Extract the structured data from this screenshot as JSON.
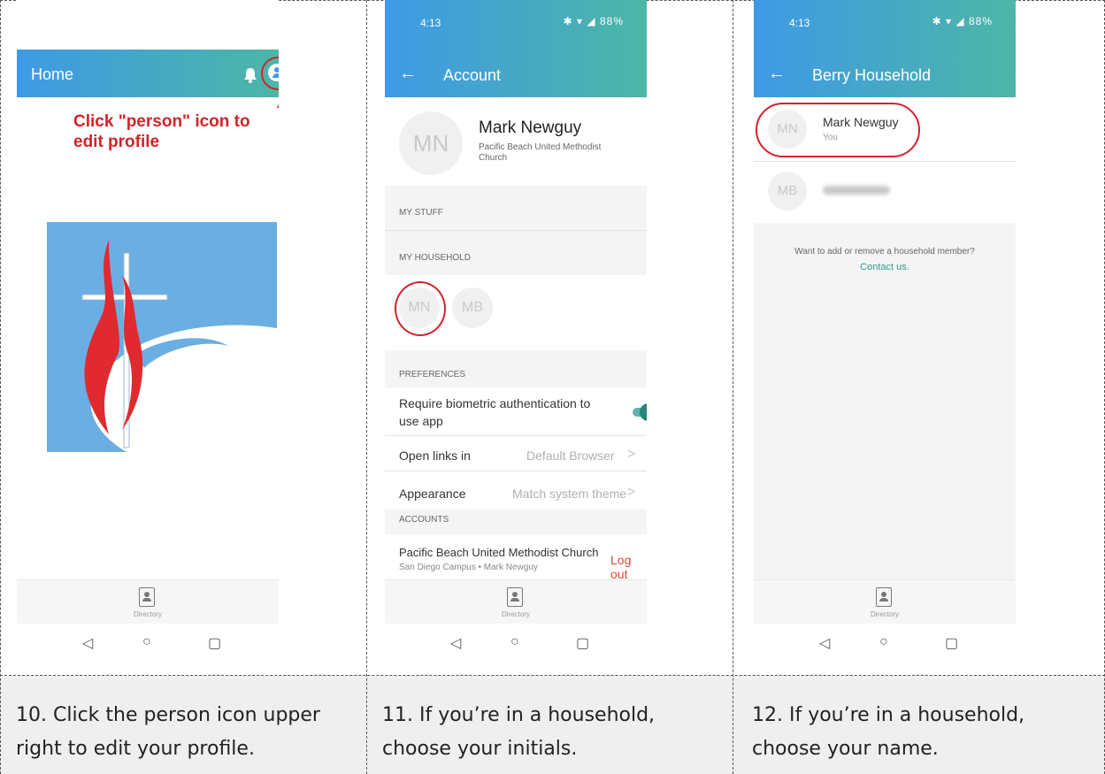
{
  "phone1": {
    "appbar_title": "Home",
    "annotation": "Click \"person\" icon to edit profile",
    "directory_label": "Directory"
  },
  "phone2": {
    "status_time": "4:13",
    "status_icons": "✱ ▾ ◢ 88%",
    "title": "Account",
    "profile_initials": "MN",
    "profile_name": "Mark Newguy",
    "profile_church": "Pacific Beach United Methodist Church",
    "my_stuff": "MY STUFF",
    "my_household": "MY HOUSEHOLD",
    "household_initials": [
      "MN",
      "MB"
    ],
    "preferences": "PREFERENCES",
    "biometric_label": "Require biometric authentication to use app",
    "biometric_on": true,
    "open_links_label": "Open links in",
    "open_links_value": "Default Browser",
    "appearance_label": "Appearance",
    "appearance_value": "Match system theme",
    "accounts": "ACCOUNTS",
    "account_church": "Pacific Beach United Methodist Church",
    "account_sub": "San Diego Campus • Mark Newguy",
    "logout": "Log out",
    "directory_label": "Directory"
  },
  "phone3": {
    "status_time": "4:13",
    "status_icons": "✱ ▾ ◢ 88%",
    "title": "Berry Household",
    "member1_initials": "MN",
    "member1_name": "Mark Newguy",
    "member1_sub": "You",
    "member2_initials": "MB",
    "note": "Want to add or remove a household member?",
    "contact": "Contact us.",
    "directory_label": "Directory"
  },
  "captions": [
    "10. Click the person icon upper right to edit your profile.",
    "11. If you’re in a household, choose your initials.",
    "12. If you’re in a household, choose your name."
  ],
  "colors": {
    "appbar_start": "#3e9ae6",
    "appbar_end": "#4db6a6",
    "annotation_red": "#d2232a",
    "toggle_teal": "#26867a",
    "link_teal": "#2a9d8f"
  }
}
